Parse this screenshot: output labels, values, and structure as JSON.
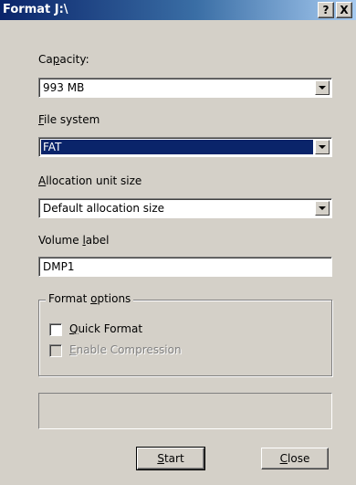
{
  "window": {
    "title": "Format J:\\",
    "help_button": "?",
    "close_button": "X"
  },
  "capacity": {
    "label_pre": "Ca",
    "label_accel": "p",
    "label_post": "acity:",
    "value": "993 MB"
  },
  "file_system": {
    "label_accel": "F",
    "label_post": "ile system",
    "value": "FAT"
  },
  "allocation": {
    "label_accel": "A",
    "label_post": "llocation unit size",
    "value": "Default allocation size"
  },
  "volume_label": {
    "label_pre": "Volume ",
    "label_accel": "l",
    "label_post": "abel",
    "value": "DMP1"
  },
  "format_options": {
    "legend_pre": "Format ",
    "legend_accel": "o",
    "legend_post": "ptions",
    "quick_format": {
      "accel": "Q",
      "post": "uick Format",
      "checked": false
    },
    "enable_compression": {
      "accel": "E",
      "post": "nable Compression",
      "checked": false,
      "enabled": false
    }
  },
  "buttons": {
    "start_accel": "S",
    "start_post": "tart",
    "close_accel": "C",
    "close_post": "lose"
  }
}
